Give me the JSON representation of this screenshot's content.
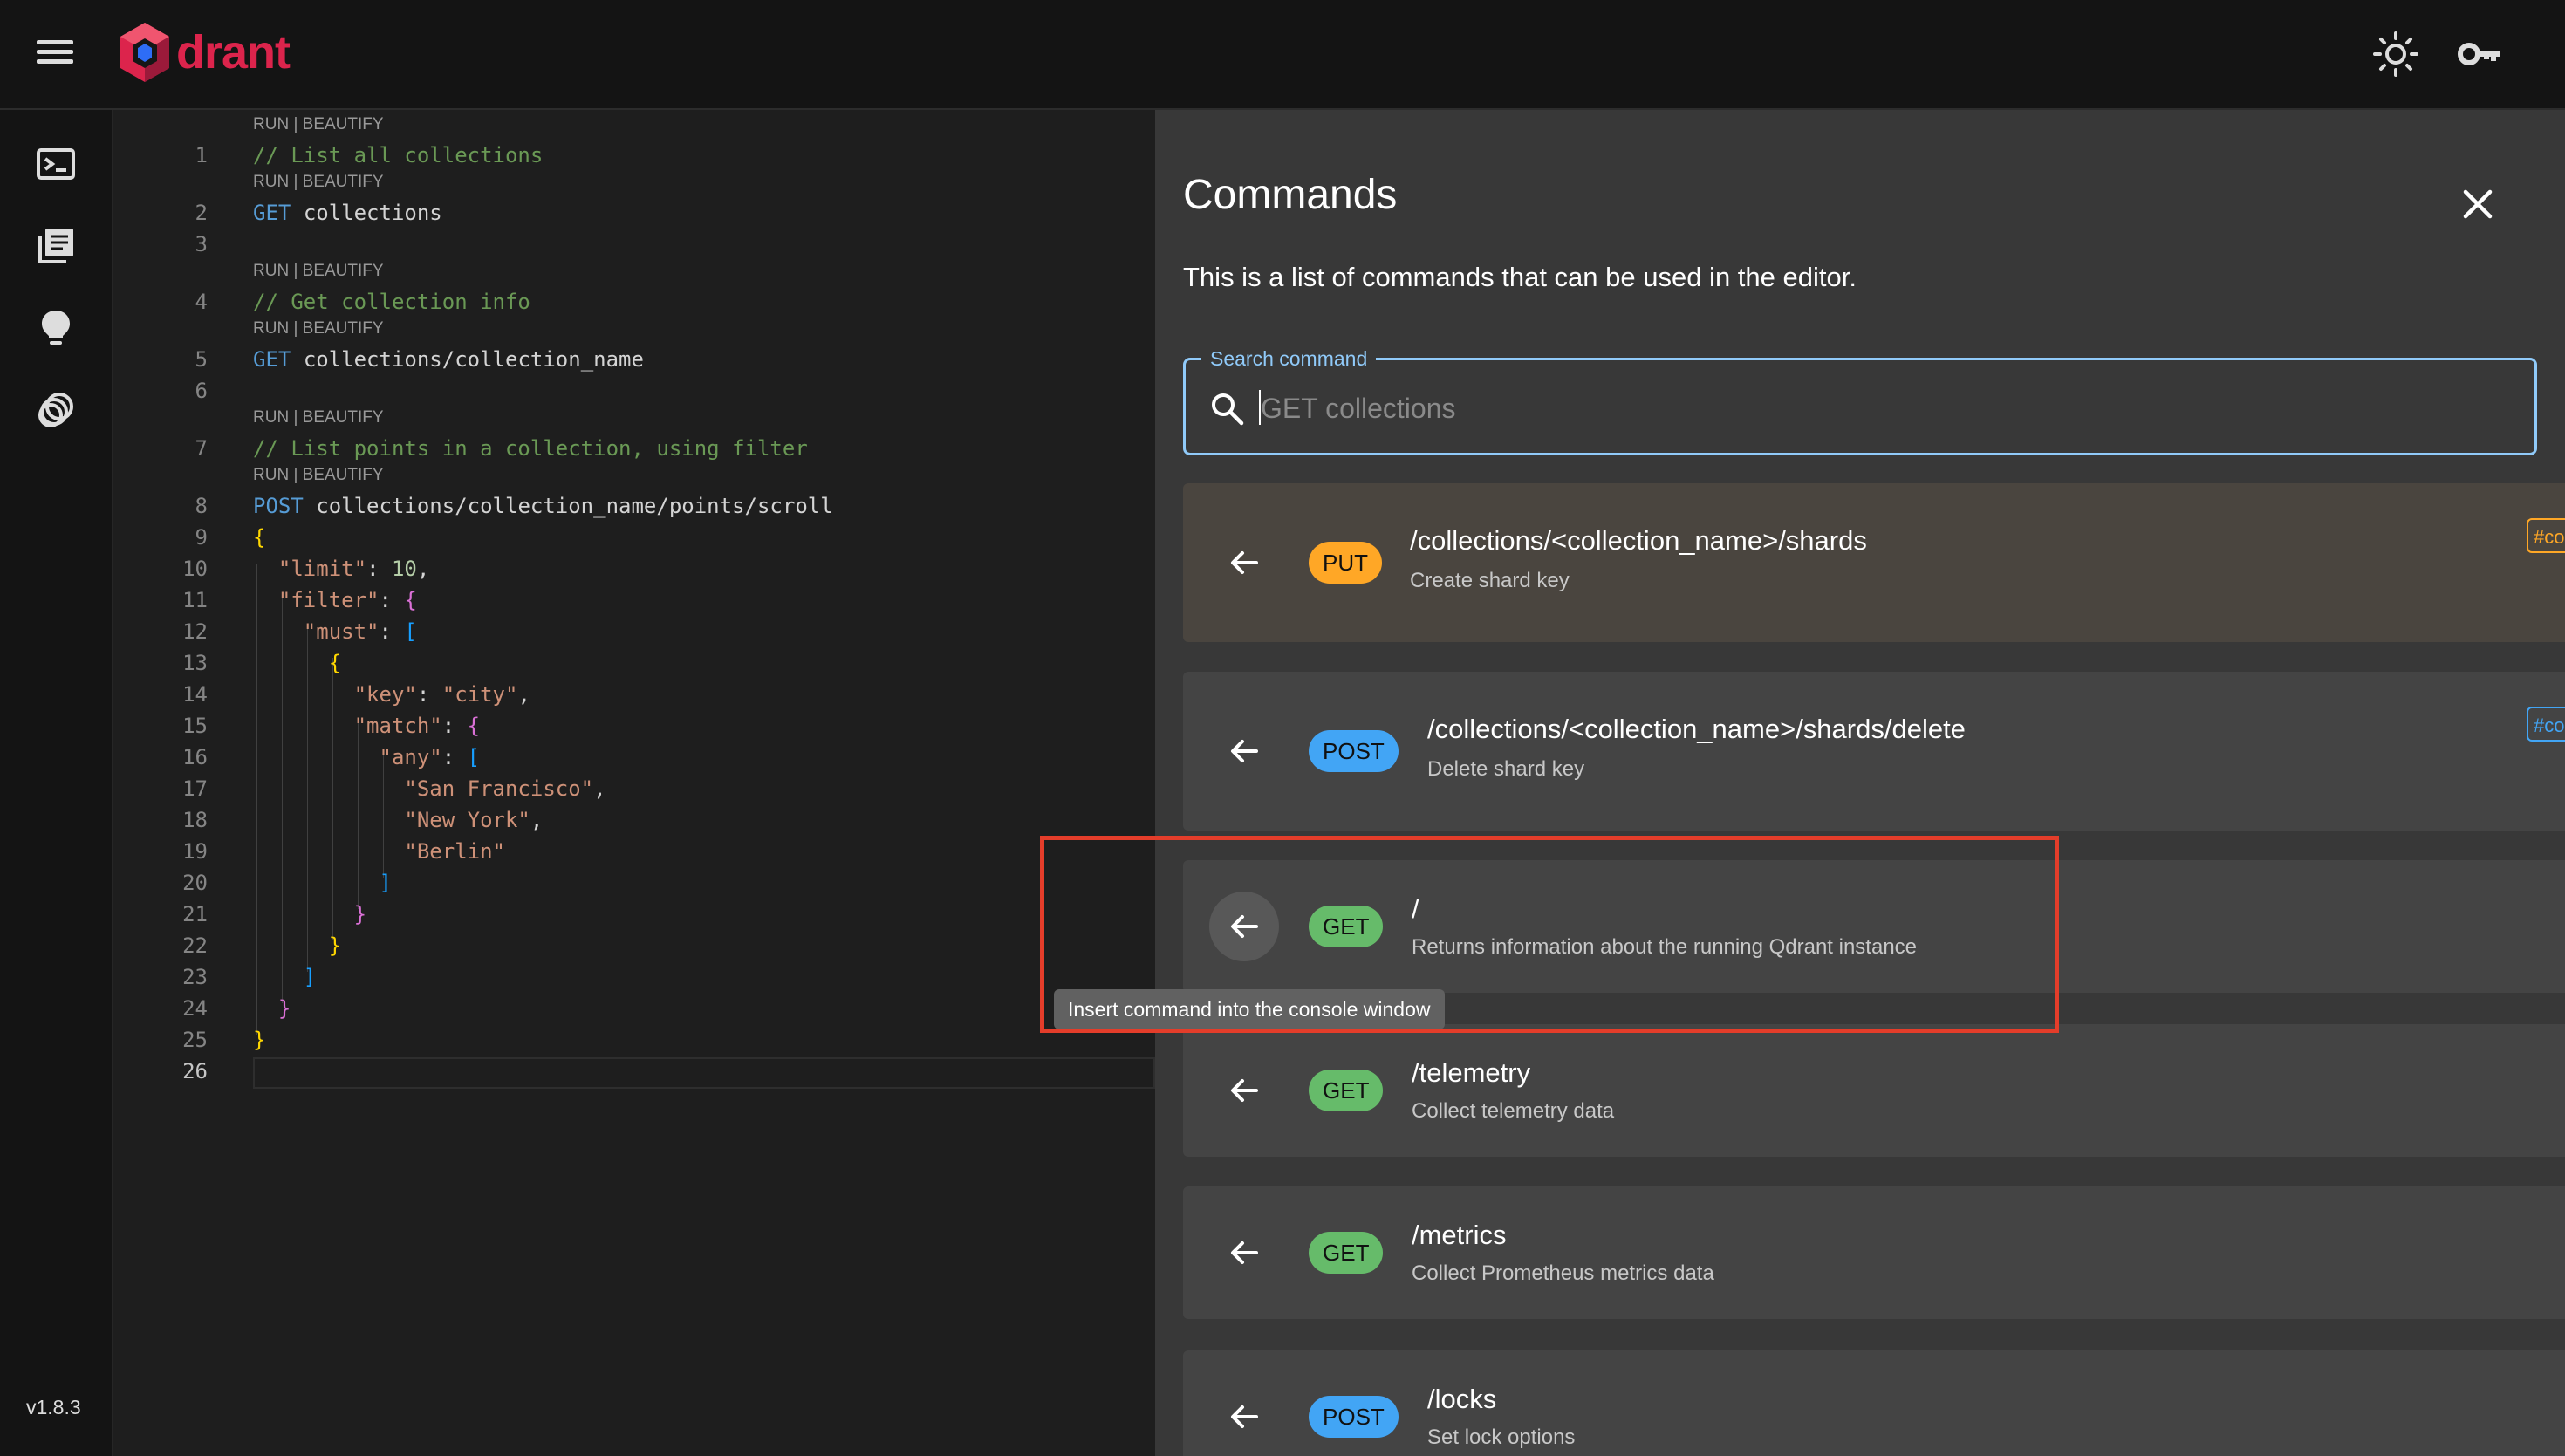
{
  "app": {
    "logo_text": "drant",
    "version": "v1.8.3"
  },
  "topbar": {
    "menu_icon": "hamburger-menu-icon",
    "theme_icon": "sun-icon",
    "api_key_icon": "key-icon"
  },
  "sidebar": {
    "items": [
      {
        "icon": "terminal-icon",
        "label": "Console"
      },
      {
        "icon": "collections-icon",
        "label": "Collections"
      },
      {
        "icon": "lightbulb-icon",
        "label": "Tutorial"
      },
      {
        "icon": "datasets-icon",
        "label": "Datasets"
      }
    ]
  },
  "editor": {
    "lens_label": "RUN | BEAUTIFY",
    "line_numbers": [
      "1",
      "2",
      "3",
      "4",
      "5",
      "6",
      "7",
      "8",
      "9",
      "10",
      "11",
      "12",
      "13",
      "14",
      "15",
      "16",
      "17",
      "18",
      "19",
      "20",
      "21",
      "22",
      "23",
      "24",
      "25",
      "26"
    ],
    "comment_1": "// List all collections",
    "method_1": "GET",
    "path_1": "collections",
    "comment_2": "// Get collection info",
    "method_2": "GET",
    "path_2": "collections/collection_name",
    "comment_3": "// List points in a collection, using filter",
    "method_3": "POST",
    "path_3": "collections/collection_name/points/scroll",
    "json": {
      "limit_key": "\"limit\"",
      "limit_value": "10",
      "filter_key": "\"filter\"",
      "must_key": "\"must\"",
      "key_key": "\"key\"",
      "key_value": "\"city\"",
      "match_key": "\"match\"",
      "any_key": "\"any\"",
      "values": [
        "\"San Francisco\"",
        "\"New York\"",
        "\"Berlin\""
      ]
    }
  },
  "commands_panel": {
    "title": "Commands",
    "description": "This is a list of commands that can be used in the editor.",
    "search_label": "Search command",
    "search_placeholder": "GET collections",
    "search_value": "",
    "tooltip": "Insert command into the console window",
    "tag_text": "#co",
    "commands": [
      {
        "method": "PUT",
        "path": "/collections/<collection_name>/shards",
        "description": "Create shard key"
      },
      {
        "method": "POST",
        "path": "/collections/<collection_name>/shards/delete",
        "description": "Delete shard key"
      },
      {
        "method": "GET",
        "path": "/",
        "description": "Returns information about the running Qdrant instance"
      },
      {
        "method": "GET",
        "path": "/telemetry",
        "description": "Collect telemetry data"
      },
      {
        "method": "GET",
        "path": "/metrics",
        "description": "Collect Prometheus metrics data"
      },
      {
        "method": "POST",
        "path": "/locks",
        "description": "Set lock options"
      }
    ]
  },
  "colors": {
    "brand": "#dc244c",
    "get": "#66bb6a",
    "post": "#42a5f5",
    "put": "#ffa726",
    "highlight": "#e43d2a",
    "focus": "#90caf9"
  }
}
